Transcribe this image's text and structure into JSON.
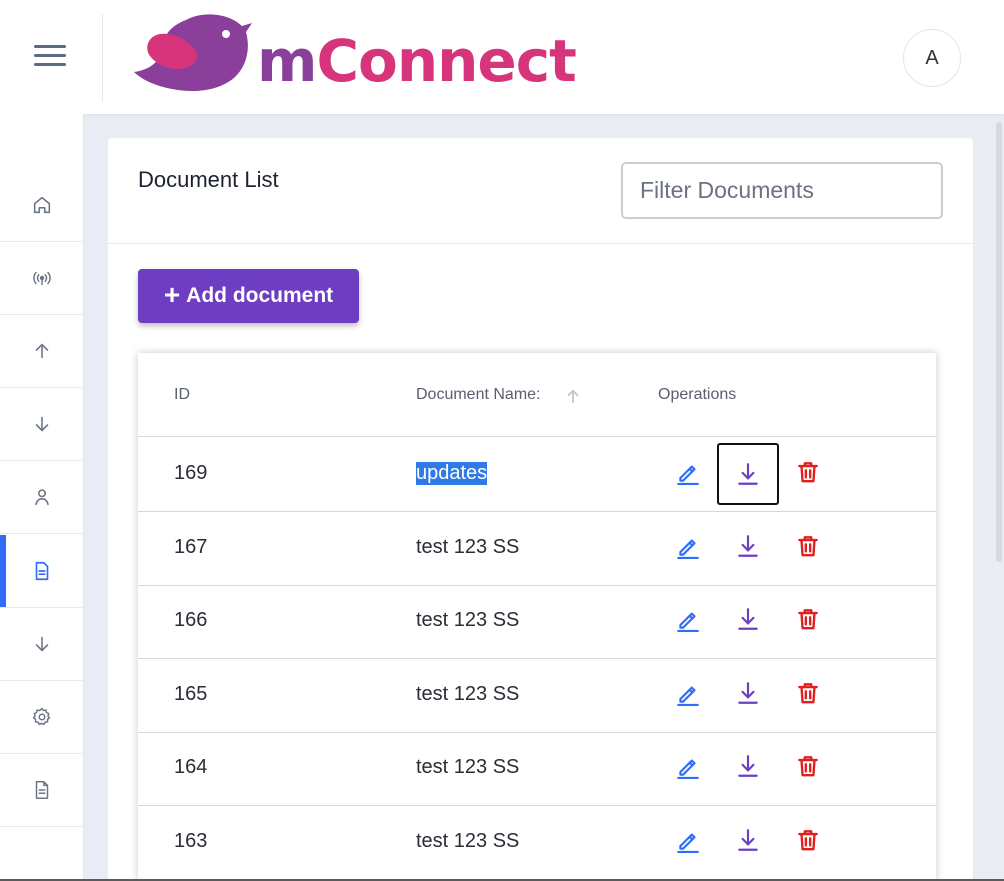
{
  "app": {
    "logo_text_prefix": "m",
    "logo_text_main": "Connect",
    "user_initial": "A"
  },
  "colors": {
    "brand_purple": "#6d3ec2",
    "logo_purple": "#8a3f9a",
    "logo_pink": "#d6357c",
    "edit_blue": "#2f6df6",
    "download_purple": "#6d3ec2",
    "delete_red": "#e0201f",
    "active_indicator": "#2f6df6"
  },
  "sidebar": {
    "items": [
      {
        "icon": "home-icon"
      },
      {
        "icon": "broadcast-icon"
      },
      {
        "icon": "arrow-up-icon"
      },
      {
        "icon": "arrow-down-icon"
      },
      {
        "icon": "user-icon"
      },
      {
        "icon": "document-icon",
        "active": true
      },
      {
        "icon": "arrow-down-icon"
      },
      {
        "icon": "gear-icon"
      },
      {
        "icon": "document-icon"
      }
    ]
  },
  "page": {
    "title": "Document List",
    "filter_placeholder": "Filter Documents",
    "add_button_label": "Add document"
  },
  "table": {
    "columns": [
      "ID",
      "Document Name:",
      "Operations"
    ],
    "sort_column": "Document Name:",
    "sort_direction": "ascending",
    "rows": [
      {
        "id": "169",
        "name": "updates",
        "selected": true
      },
      {
        "id": "167",
        "name": "test 123 SS"
      },
      {
        "id": "166",
        "name": "test 123 SS"
      },
      {
        "id": "165",
        "name": "test 123 SS"
      },
      {
        "id": "164",
        "name": "test 123 SS"
      },
      {
        "id": "163",
        "name": "test 123 SS"
      }
    ]
  }
}
